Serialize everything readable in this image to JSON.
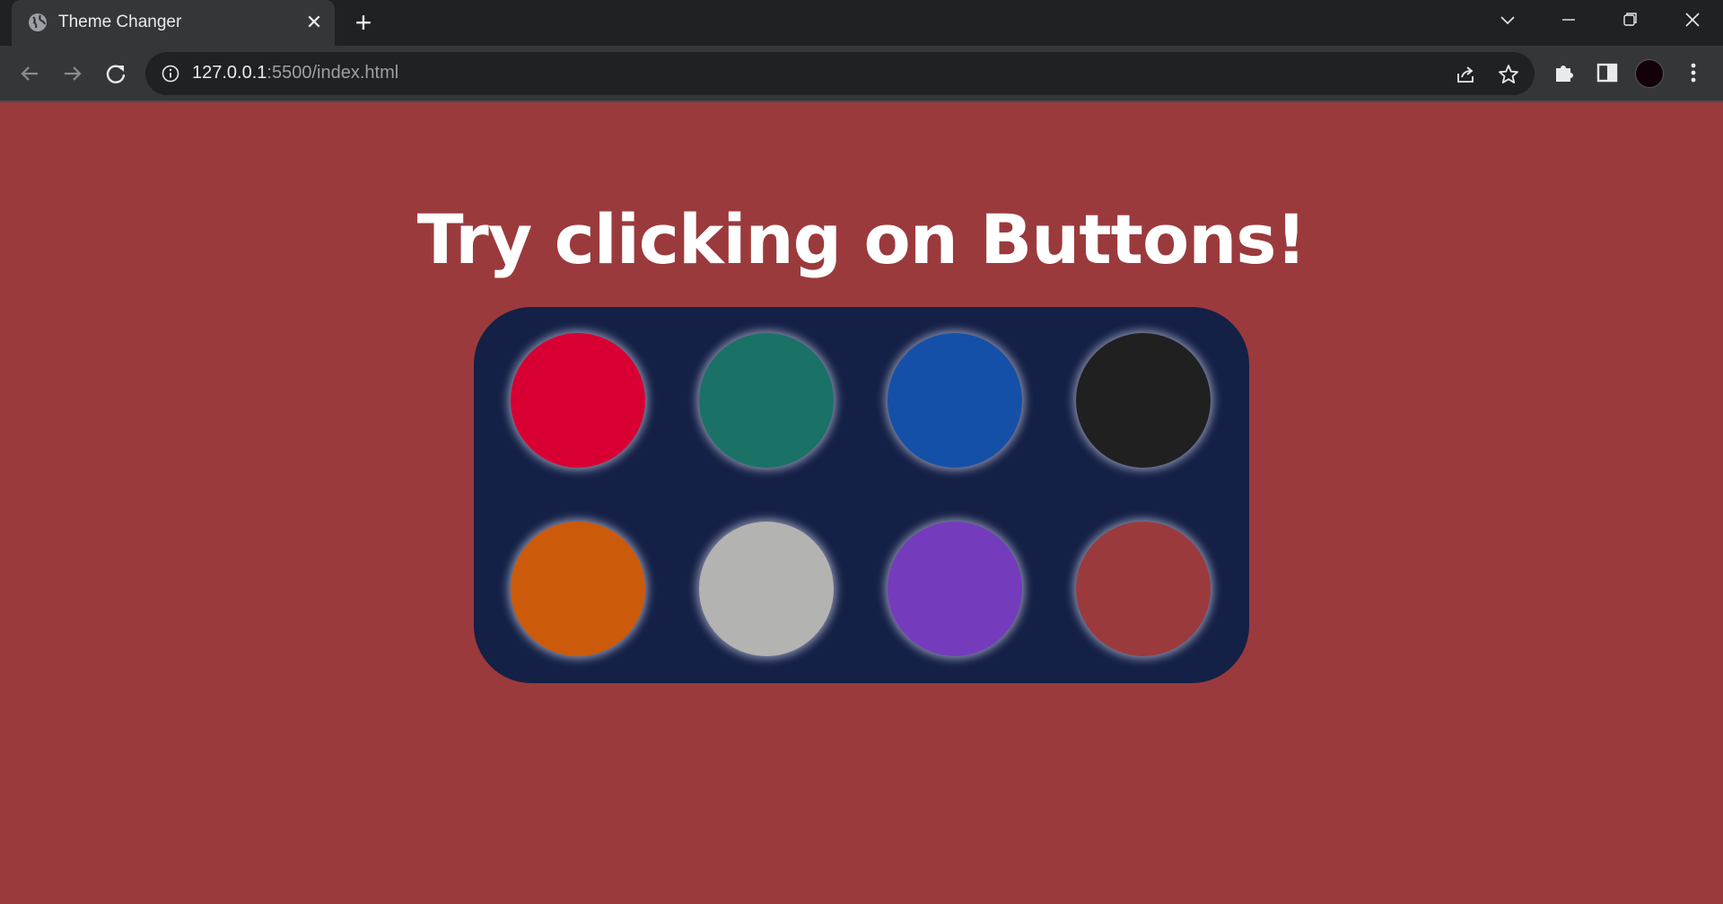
{
  "browser": {
    "tab_title": "Theme Changer",
    "tab_close": "✕",
    "new_tab": "+",
    "url_host": "127.0.0.1",
    "url_rest": ":5500/index.html"
  },
  "page": {
    "heading": "Try clicking on Buttons!",
    "background_color": "#9b3a3c",
    "panel_color": "#142046",
    "buttons": [
      {
        "color": "#d80032"
      },
      {
        "color": "#1a7166"
      },
      {
        "color": "#1550a8"
      },
      {
        "color": "#202020"
      },
      {
        "color": "#cb5a0a"
      },
      {
        "color": "#b3b3b1"
      },
      {
        "color": "#753bbd"
      },
      {
        "color": "#9b3a3c"
      }
    ]
  }
}
